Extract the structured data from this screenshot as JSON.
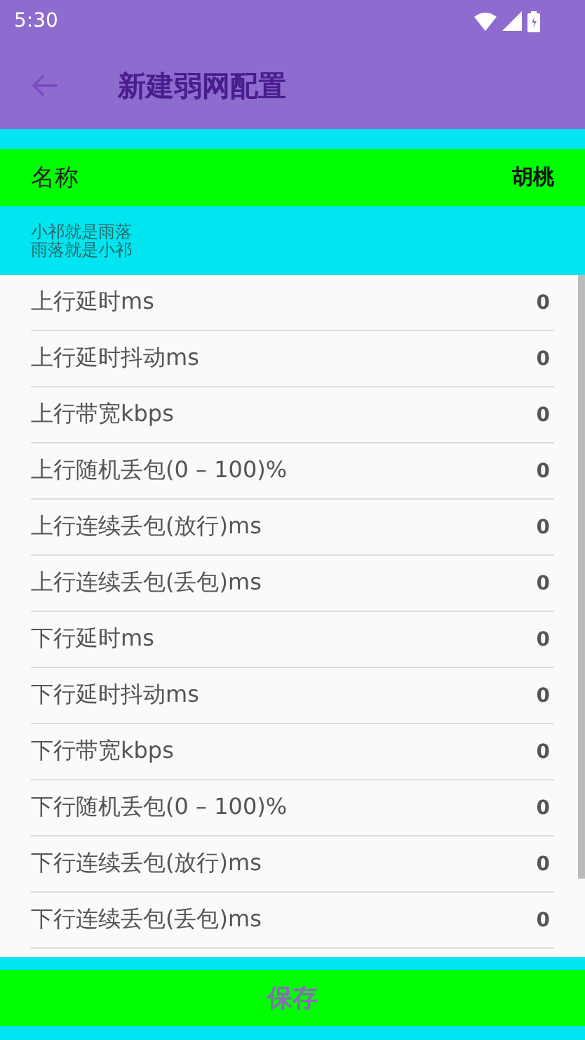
{
  "status_bar": {
    "time": "5:30"
  },
  "app_bar": {
    "title": "新建弱网配置"
  },
  "name_row": {
    "label": "名称",
    "value": "胡桃"
  },
  "description": [
    "小祁就是雨落",
    "雨落就是小祁"
  ],
  "settings": [
    {
      "label": "上行延时ms",
      "value": "0"
    },
    {
      "label": "上行延时抖动ms",
      "value": "0"
    },
    {
      "label": "上行带宽kbps",
      "value": "0"
    },
    {
      "label": "上行随机丢包(0 – 100)%",
      "value": "0"
    },
    {
      "label": "上行连续丢包(放行)ms",
      "value": "0"
    },
    {
      "label": "上行连续丢包(丢包)ms",
      "value": "0"
    },
    {
      "label": "下行延时ms",
      "value": "0"
    },
    {
      "label": "下行延时抖动ms",
      "value": "0"
    },
    {
      "label": "下行带宽kbps",
      "value": "0"
    },
    {
      "label": "下行随机丢包(0 – 100)%",
      "value": "0"
    },
    {
      "label": "下行连续丢包(放行)ms",
      "value": "0"
    },
    {
      "label": "下行连续丢包(丢包)ms",
      "value": "0"
    }
  ],
  "save_button": "保存"
}
